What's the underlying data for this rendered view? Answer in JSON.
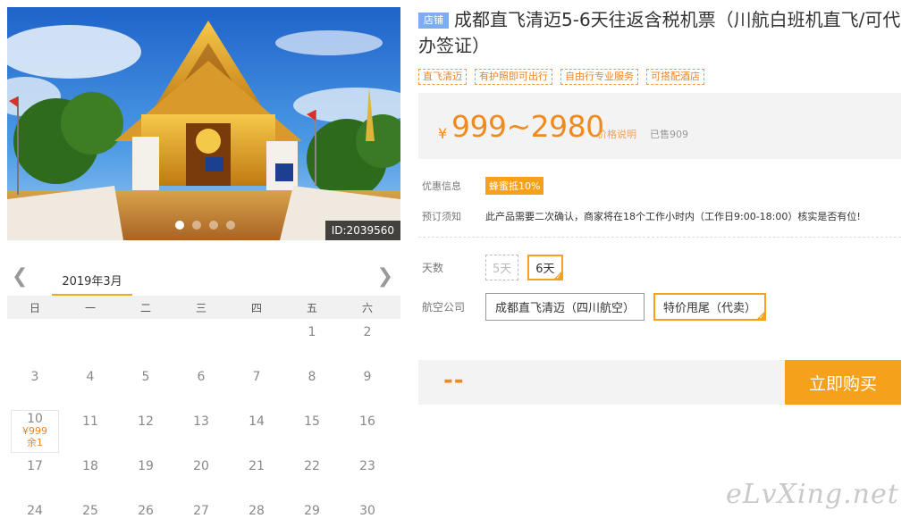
{
  "hero": {
    "image_id": "ID:2039560",
    "slide_count": 4,
    "active_slide": 1
  },
  "calendar": {
    "month_label": "2019年3月",
    "prev_icon": "chevron-left-icon",
    "next_icon": "chevron-right-icon",
    "weekdays": [
      "日",
      "一",
      "二",
      "三",
      "四",
      "五",
      "六"
    ],
    "days": [
      [
        "",
        "",
        "",
        "",
        "",
        "1",
        "2"
      ],
      [
        "3",
        "4",
        "5",
        "6",
        "7",
        "8",
        "9"
      ],
      [
        "10",
        "11",
        "12",
        "13",
        "14",
        "15",
        "16"
      ],
      [
        "17",
        "18",
        "19",
        "20",
        "21",
        "22",
        "23"
      ],
      [
        "24",
        "25",
        "26",
        "27",
        "28",
        "29",
        "30"
      ]
    ],
    "available": {
      "day": "10",
      "price": "¥999",
      "remaining": "余1"
    }
  },
  "product": {
    "store_badge": "店铺",
    "title": "成都直飞清迈5-6天往返含税机票（川航白班机直飞/可代办签证）",
    "tags": [
      "直飞清迈",
      "有护照即可出行",
      "自由行专业服务",
      "可搭配酒店"
    ]
  },
  "price": {
    "currency": "¥",
    "range": "999~2980",
    "note": "价格说明",
    "sold": "已售909"
  },
  "info": {
    "promo_label": "优惠信息",
    "promo_badge": "蜂蜜抵10%",
    "booking_label": "预订须知",
    "booking_text": "此产品需要二次确认，商家将在18个工作小时内（工作日9:00-18:00）核实是否有位!"
  },
  "options": {
    "days_label": "天数",
    "days": [
      {
        "label": "5天",
        "state": "disabled"
      },
      {
        "label": "6天",
        "state": "selected"
      }
    ],
    "airline_label": "航空公司",
    "airlines": [
      {
        "label": "成都直飞清迈（四川航空）",
        "state": "normal"
      },
      {
        "label": "特价甩尾（代卖）",
        "state": "selected"
      }
    ]
  },
  "purchase": {
    "total": "--",
    "button": "立即购买"
  },
  "watermark": "eLvXing.net",
  "colors": {
    "accent": "#f5a11c",
    "price": "#f08a1d",
    "badge_blue": "#7cadf0"
  }
}
